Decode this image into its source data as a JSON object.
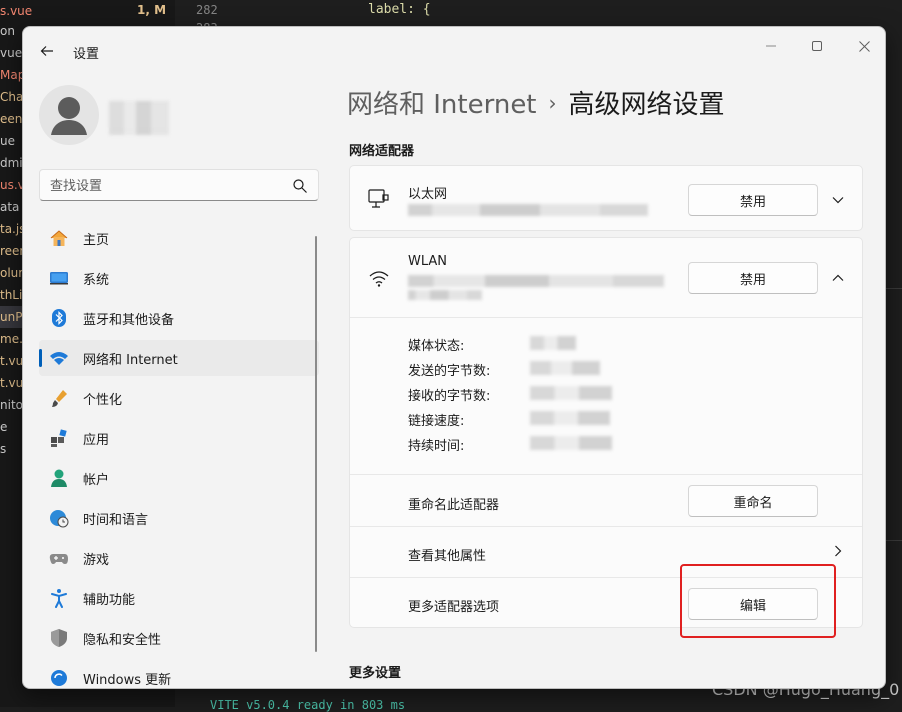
{
  "editor": {
    "files": [
      "on",
      "vue",
      "Map",
      "Char",
      "een.",
      "ue",
      "dmi",
      "us.vu",
      "ata",
      "ta.js",
      "reen",
      "olum",
      "thLi",
      "unP",
      "me.",
      "t.vue",
      "t.vue",
      "nito",
      "e",
      "s"
    ],
    "file_colors": [
      "#cccccc",
      "#cccccc",
      "#f48771",
      "#e2c08d",
      "#e2c08d",
      "#cccccc",
      "#cccccc",
      "#f48771",
      "#cccccc",
      "#e2c08d",
      "#e2c08d",
      "#e2c08d",
      "#e2c08d",
      "#e2c08d",
      "#e2c08d",
      "#e2c08d",
      "#e2c08d",
      "#cccccc",
      "#cccccc",
      "#cccccc"
    ],
    "top_file": "s.vue",
    "top_file_status": "1, M",
    "line_numbers": [
      "282",
      "283"
    ],
    "code_line": "label: {",
    "terminal_line": "VITE v5.0.4  ready in 803 ms",
    "watermark": "CSDN @Hugo_Huang_0"
  },
  "window": {
    "title": "设置"
  },
  "search": {
    "placeholder": "查找设置"
  },
  "nav": {
    "items": [
      {
        "label": "主页",
        "icon": "home-icon"
      },
      {
        "label": "系统",
        "icon": "system-icon"
      },
      {
        "label": "蓝牙和其他设备",
        "icon": "bluetooth-icon"
      },
      {
        "label": "网络和 Internet",
        "icon": "wifi-icon",
        "active": true
      },
      {
        "label": "个性化",
        "icon": "brush-icon"
      },
      {
        "label": "应用",
        "icon": "apps-icon"
      },
      {
        "label": "帐户",
        "icon": "account-icon"
      },
      {
        "label": "时间和语言",
        "icon": "globe-clock-icon"
      },
      {
        "label": "游戏",
        "icon": "gamepad-icon"
      },
      {
        "label": "辅助功能",
        "icon": "accessibility-icon"
      },
      {
        "label": "隐私和安全性",
        "icon": "shield-icon"
      },
      {
        "label": "Windows 更新",
        "icon": "windows-update-icon"
      }
    ]
  },
  "breadcrumb": {
    "parent": "网络和 Internet",
    "separator": "›",
    "current": "高级网络设置"
  },
  "sections": {
    "adapters": "网络适配器",
    "more": "更多设置"
  },
  "ethernet": {
    "name": "以太网",
    "disable_label": "禁用"
  },
  "wlan": {
    "name": "WLAN",
    "disable_label": "禁用",
    "properties": [
      {
        "label": "媒体状态:"
      },
      {
        "label": "发送的字节数:"
      },
      {
        "label": "接收的字节数:"
      },
      {
        "label": "链接速度:"
      },
      {
        "label": "持续时间:"
      }
    ],
    "rename_label": "重命名此适配器",
    "rename_button": "重命名",
    "view_props_label": "查看其他属性",
    "more_options_label": "更多适配器选项",
    "edit_button": "编辑"
  },
  "colors": {
    "accent": "#005fb8",
    "highlight": "#e02020"
  }
}
